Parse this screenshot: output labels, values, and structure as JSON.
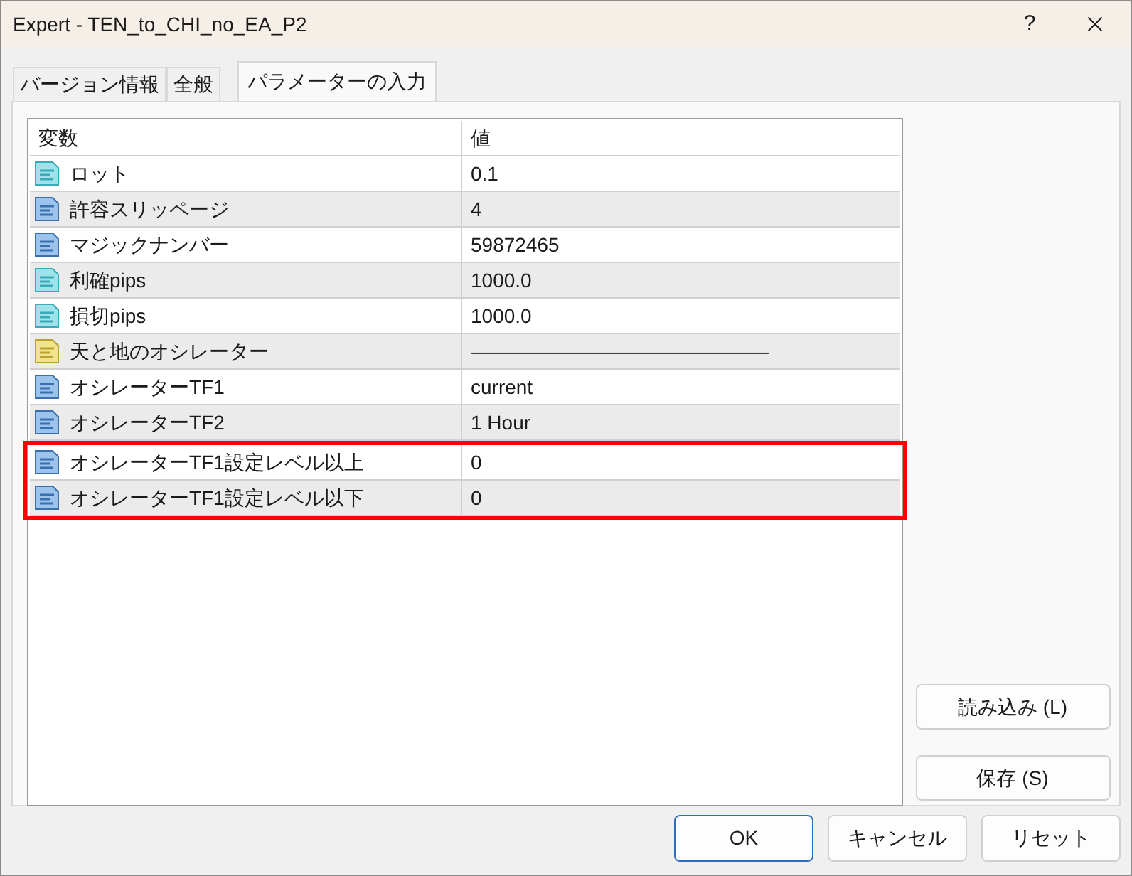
{
  "window": {
    "title": "Expert - TEN_to_CHI_no_EA_P2",
    "help": "?"
  },
  "tabs": [
    {
      "label": "バージョン情報",
      "selected": false
    },
    {
      "label": "全般",
      "selected": false
    },
    {
      "label": "パラメーターの入力",
      "selected": true
    }
  ],
  "table": {
    "columns": [
      "変数",
      "値"
    ],
    "rows": [
      {
        "kind": "double",
        "name": "ロット",
        "value": "0.1",
        "outlined": false
      },
      {
        "kind": "int",
        "name": "許容スリッページ",
        "value": "4",
        "outlined": false
      },
      {
        "kind": "int",
        "name": "マジックナンバー",
        "value": "59872465",
        "outlined": false
      },
      {
        "kind": "double",
        "name": "利確pips",
        "value": "1000.0",
        "outlined": false
      },
      {
        "kind": "double",
        "name": "損切pips",
        "value": "1000.0",
        "outlined": false
      },
      {
        "kind": "string",
        "name": "天と地のオシレーター",
        "value": "———————————————",
        "outlined": false
      },
      {
        "kind": "int",
        "name": "オシレーターTF1",
        "value": "current",
        "outlined": false
      },
      {
        "kind": "int",
        "name": "オシレーターTF2",
        "value": "1 Hour",
        "outlined": false
      },
      {
        "kind": "int",
        "name": "オシレーターTF1設定レベル以上",
        "value": "0",
        "outlined": true
      },
      {
        "kind": "int",
        "name": "オシレーターTF1設定レベル以下",
        "value": "0",
        "outlined": true
      }
    ]
  },
  "side_buttons": [
    "読み込み (L)",
    "保存 (S)"
  ],
  "buttons": [
    {
      "label": "OK",
      "default": true
    },
    {
      "label": "キャンセル",
      "default": false
    },
    {
      "label": "リセット",
      "default": false
    }
  ]
}
